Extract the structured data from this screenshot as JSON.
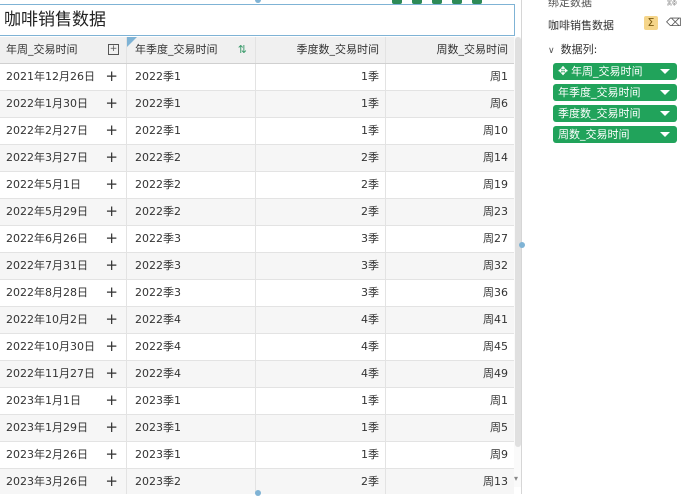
{
  "widget": {
    "title": "咖啡销售数据",
    "columns": [
      "年周_交易时间",
      "年季度_交易时间",
      "季度数_交易时间",
      "周数_交易时间"
    ],
    "rows": [
      [
        "2021年12月26日",
        "2022季1",
        "1季",
        "周1"
      ],
      [
        "2022年1月30日",
        "2022季1",
        "1季",
        "周6"
      ],
      [
        "2022年2月27日",
        "2022季1",
        "1季",
        "周10"
      ],
      [
        "2022年3月27日",
        "2022季2",
        "2季",
        "周14"
      ],
      [
        "2022年5月1日",
        "2022季2",
        "2季",
        "周19"
      ],
      [
        "2022年5月29日",
        "2022季2",
        "2季",
        "周23"
      ],
      [
        "2022年6月26日",
        "2022季3",
        "3季",
        "周27"
      ],
      [
        "2022年7月31日",
        "2022季3",
        "3季",
        "周32"
      ],
      [
        "2022年8月28日",
        "2022季3",
        "3季",
        "周36"
      ],
      [
        "2022年10月2日",
        "2022季4",
        "4季",
        "周41"
      ],
      [
        "2022年10月30日",
        "2022季4",
        "4季",
        "周45"
      ],
      [
        "2022年11月27日",
        "2022季4",
        "4季",
        "周49"
      ],
      [
        "2023年1月1日",
        "2023季1",
        "1季",
        "周1"
      ],
      [
        "2023年1月29日",
        "2023季1",
        "1季",
        "周5"
      ],
      [
        "2023年2月26日",
        "2023季1",
        "1季",
        "周9"
      ],
      [
        "2023年3月26日",
        "2023季2",
        "2季",
        "周13"
      ]
    ]
  },
  "panel": {
    "header": "绑定数据",
    "dataset_name": "咖啡销售数据",
    "data_columns_label": "数据列:",
    "fields": [
      "年周_交易时间",
      "年季度_交易时间",
      "季度数_交易时间",
      "周数_交易时间"
    ]
  },
  "icons": {
    "expand": "plus-icon",
    "sum": "sigma-icon",
    "clear": "eraser-icon",
    "sort": "sort-icon",
    "move": "move-icon",
    "dropdown": "caret-down-icon"
  },
  "colors": {
    "field_chip": "#21a35b",
    "selection": "#7fb3d5",
    "sum_badge": "#f5d58a"
  }
}
